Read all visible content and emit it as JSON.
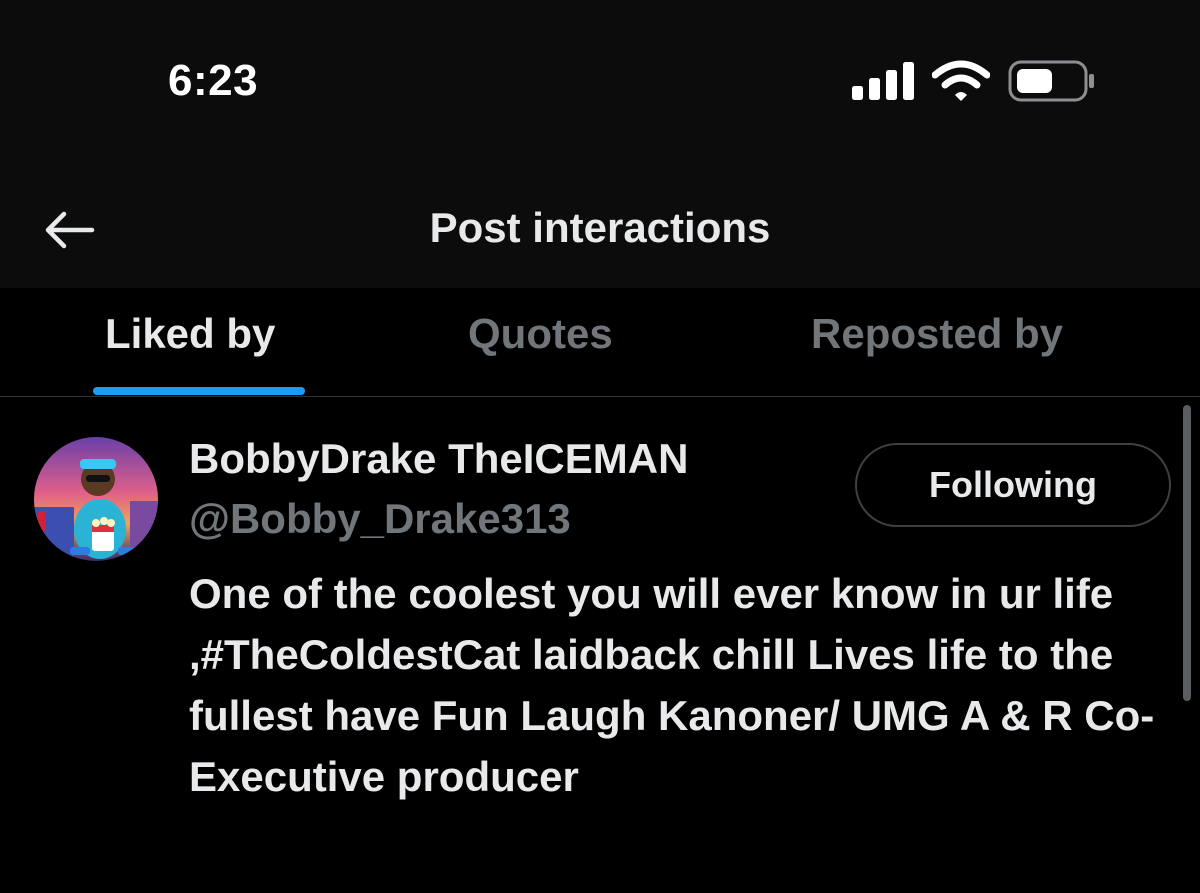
{
  "status_bar": {
    "time": "6:23",
    "icons": [
      "signal-icon",
      "wifi-icon",
      "battery-icon"
    ]
  },
  "header": {
    "title": "Post interactions",
    "back_icon": "arrow-left-icon"
  },
  "tabs": [
    {
      "label": "Liked by",
      "active": true
    },
    {
      "label": "Quotes",
      "active": false
    },
    {
      "label": "Reposted by",
      "active": false
    }
  ],
  "users": [
    {
      "display_name": "BobbyDrake TheICEMAN",
      "handle": "@Bobby_Drake313",
      "follow_label": "Following",
      "bio": "One of the coolest you will ever know in ur life ,#TheColdestCat laidback chill Lives life to the fullest have Fun Laugh Kanoner/ UMG A & R Co-Executive producer"
    }
  ],
  "colors": {
    "accent": "#1d9bf0",
    "background": "#000000",
    "header_background": "#0c0c0c",
    "primary_text": "#e7e9ea",
    "secondary_text": "#71767b"
  }
}
